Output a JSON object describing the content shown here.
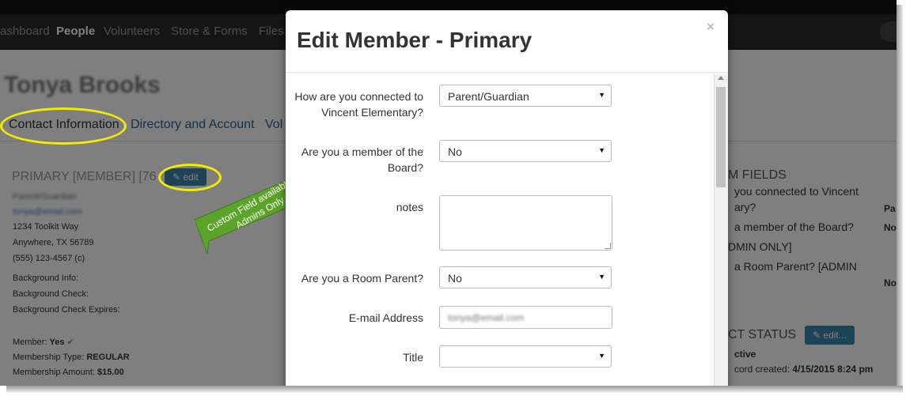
{
  "nav": {
    "items": [
      "ashboard",
      "People",
      "Volunteers",
      "Store & Forms",
      "Files"
    ],
    "active": "People"
  },
  "page": {
    "member_name": "Tonya Brooks",
    "tabs": [
      "Contact Information",
      "Directory and Account",
      "Vol"
    ],
    "primary_heading": "PRIMARY [MEMBER] [76",
    "edit_label": "edit",
    "contact": {
      "role": "Parent/Guardian",
      "email": "tonya@email.com",
      "address1": "1234 Toolkit Way",
      "address2": "Anywhere, TX 56789",
      "phone": "(555) 123-4567 (c)"
    },
    "background": {
      "info": "Background Info:",
      "check": "Background Check:",
      "expires": "Background Check Expires:"
    },
    "membership": {
      "member_label": "Member:",
      "member_value": "Yes",
      "type_label": "Membership Type:",
      "type_value": "REGULAR",
      "amount_label": "Membership Amount:",
      "amount_value": "$15.00"
    },
    "custom_fields": {
      "heading": "M FIELDS",
      "lines": [
        "you connected to Vincent",
        "ary?",
        "a member of the Board?",
        "DMIN ONLY]",
        "a Room Parent? [ADMIN"
      ],
      "values": [
        "Pa",
        "No",
        "No"
      ]
    },
    "contact_status": {
      "heading": "CT STATUS",
      "edit_label": "edit...",
      "status_text": "ctive",
      "record_created_label": "cord created:",
      "record_created_value": "4/15/2015 8:24 pm"
    }
  },
  "modal": {
    "title": "Edit Member - Primary",
    "close": "×",
    "fields": [
      {
        "label": "How are you connected to Vincent Elementary?",
        "type": "select",
        "value": "Parent/Guardian"
      },
      {
        "label": "Are you a member of the Board?",
        "type": "select",
        "value": "No"
      },
      {
        "label": "notes",
        "type": "textarea",
        "value": ""
      },
      {
        "label": "Are you a Room Parent?",
        "type": "select",
        "value": "No"
      },
      {
        "label": "E-mail Address",
        "type": "input",
        "value": "tonya@email.com"
      },
      {
        "label": "Title",
        "type": "select",
        "value": ""
      }
    ]
  },
  "callout": {
    "text": "Custom Field available to Admins Only",
    "color": "#5ca429"
  },
  "colors": {
    "highlight": "#f2ed00",
    "link": "#2a6496",
    "navbar": "#2a2a2a",
    "button": "#3a87ad"
  }
}
